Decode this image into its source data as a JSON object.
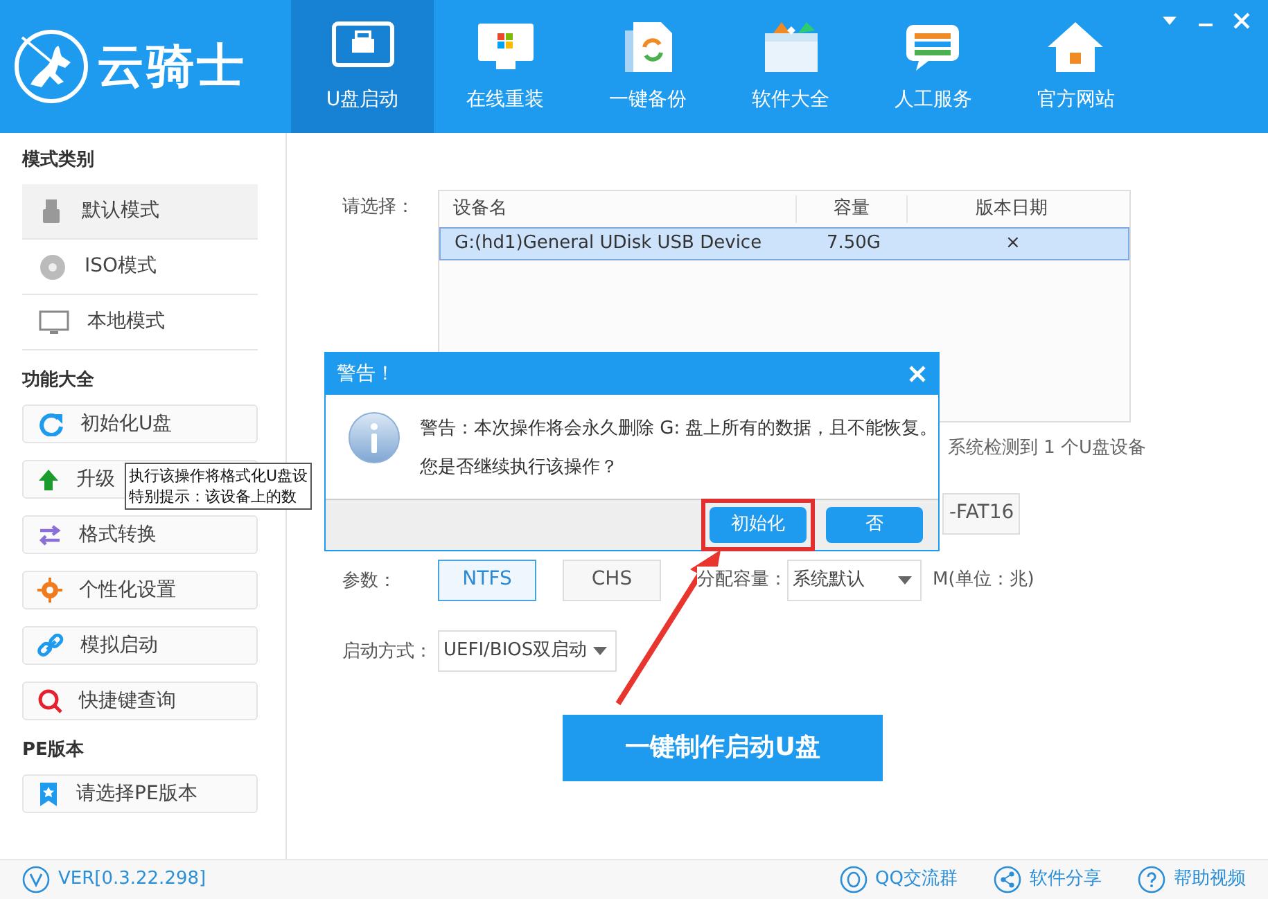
{
  "app": {
    "title": "云骑士"
  },
  "window_controls": [
    {
      "kind": "dropdown"
    },
    {
      "kind": "minimize"
    },
    {
      "kind": "close"
    }
  ],
  "tabs": [
    {
      "label": "U盘启动",
      "kind": "usb",
      "selected": true
    },
    {
      "label": "在线重装",
      "kind": "monitor",
      "selected": false
    },
    {
      "label": "一键备份",
      "kind": "backup",
      "selected": false
    },
    {
      "label": "软件大全",
      "kind": "box",
      "selected": false
    },
    {
      "label": "人工服务",
      "kind": "chat",
      "selected": false
    },
    {
      "label": "官方网站",
      "kind": "home",
      "selected": false
    }
  ],
  "sidebar": [
    {
      "heading": "模式类别",
      "kind": "list",
      "items": [
        {
          "label": "默认模式",
          "kind": "usb",
          "selected": true
        },
        {
          "label": "ISO模式",
          "kind": "disc",
          "selected": false
        },
        {
          "label": "本地模式",
          "kind": "monitor",
          "selected": false
        }
      ]
    },
    {
      "heading": "功能大全",
      "kind": "buttons",
      "items": [
        {
          "label": "初始化U盘",
          "kind": "refresh"
        },
        {
          "label": "升级",
          "kind": "up"
        },
        {
          "label": "格式转换",
          "kind": "swap"
        },
        {
          "label": "个性化设置",
          "kind": "gear"
        },
        {
          "label": "模拟启动",
          "kind": "link"
        },
        {
          "label": "快捷键查询",
          "kind": "search"
        }
      ]
    },
    {
      "heading": "PE版本",
      "kind": "buttons",
      "items": [
        {
          "label": "请选择PE版本",
          "kind": "bookmark"
        }
      ]
    }
  ],
  "tooltip": {
    "lines": [
      "执行该操作将格式化U盘设",
      "特别提示：该设备上的数"
    ]
  },
  "main": {
    "select_label": "请选择：",
    "device_table": {
      "columns": [
        "设备名",
        "容量",
        "版本日期"
      ],
      "rows": [
        {
          "cells": [
            "G:(hd1)General UDisk USB Device",
            "7.50G",
            "×"
          ],
          "selected": true
        }
      ]
    },
    "detect_note": "系统检测到 1 个U盘设备",
    "format_buttons": [
      {
        "label": "-FAT16"
      }
    ],
    "params": {
      "label": "参数：",
      "options": [
        {
          "label": "NTFS",
          "selected": true
        },
        {
          "label": "CHS",
          "selected": false
        }
      ],
      "alloc_label": "分配容量：",
      "alloc_value": "系统默认",
      "unit": "M(单位：兆)"
    },
    "boot": {
      "label": "启动方式：",
      "value": "UEFI/BIOS双启动"
    },
    "make_button": "一键制作启动U盘"
  },
  "dialog": {
    "title": "警告！",
    "message_lines": [
      "警告：本次操作将会永久删除 G: 盘上所有的数据，且不能恢复。",
      "您是否继续执行该操作？"
    ],
    "buttons": [
      {
        "label": "初始化",
        "highlighted": true
      },
      {
        "label": "否",
        "highlighted": false
      }
    ]
  },
  "footer": {
    "version": "VER[0.3.22.298]",
    "links": [
      {
        "label": "QQ交流群",
        "kind": "qq"
      },
      {
        "label": "软件分享",
        "kind": "share"
      },
      {
        "label": "帮助视频",
        "kind": "help"
      }
    ]
  }
}
